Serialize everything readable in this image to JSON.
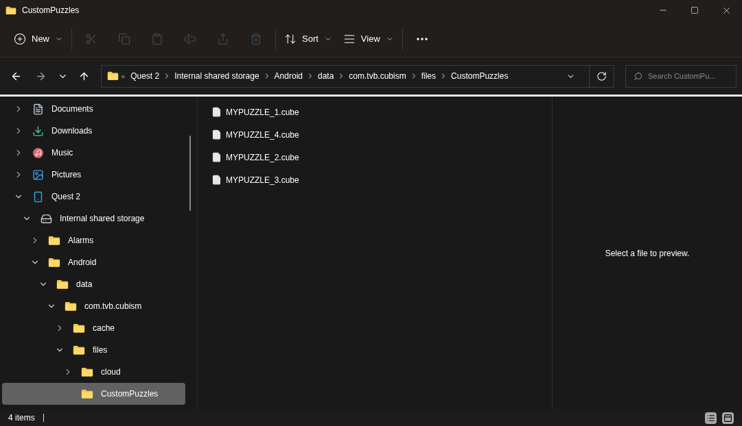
{
  "window": {
    "title": "CustomPuzzles"
  },
  "toolbar": {
    "items": [
      {
        "kind": "new",
        "label": "New",
        "disabled": false
      },
      {
        "kind": "cut",
        "disabled": true
      },
      {
        "kind": "copy",
        "disabled": true
      },
      {
        "kind": "paste",
        "disabled": true
      },
      {
        "kind": "rename",
        "disabled": true
      },
      {
        "kind": "share",
        "disabled": true
      },
      {
        "kind": "delete",
        "disabled": true
      },
      {
        "kind": "sort",
        "label": "Sort",
        "disabled": false
      },
      {
        "kind": "view",
        "label": "View",
        "disabled": false
      },
      {
        "kind": "more",
        "disabled": false
      }
    ]
  },
  "navigation": {
    "back_disabled": false,
    "forward_disabled": true
  },
  "address_bar": {
    "overflow": "«",
    "segments": [
      "Quest 2",
      "Internal shared storage",
      "Android",
      "data",
      "com.tvb.cubism",
      "files",
      "CustomPuzzles"
    ]
  },
  "search": {
    "placeholder": "Search CustomPu..."
  },
  "sidebar": {
    "items": [
      {
        "label": "Documents",
        "kind": "document",
        "expanded": false,
        "selected": false
      },
      {
        "label": "Downloads",
        "kind": "download",
        "expanded": false,
        "selected": false
      },
      {
        "label": "Music",
        "kind": "music",
        "expanded": false,
        "selected": false
      },
      {
        "label": "Pictures",
        "kind": "pictures",
        "expanded": false,
        "selected": false
      },
      {
        "label": "Quest 2",
        "kind": "device",
        "expanded": true,
        "selected": false,
        "children": [
          {
            "label": "Internal shared storage",
            "kind": "drive",
            "expanded": true,
            "selected": false,
            "children": [
              {
                "label": "Alarms",
                "kind": "folder",
                "expanded": false,
                "selected": false
              },
              {
                "label": "Android",
                "kind": "folder",
                "expanded": true,
                "selected": false,
                "children": [
                  {
                    "label": "data",
                    "kind": "folder",
                    "expanded": true,
                    "selected": false,
                    "children": [
                      {
                        "label": "com.tvb.cubism",
                        "kind": "folder",
                        "expanded": true,
                        "selected": false,
                        "children": [
                          {
                            "label": "cache",
                            "kind": "folder",
                            "expanded": false,
                            "selected": false
                          },
                          {
                            "label": "files",
                            "kind": "folder",
                            "expanded": true,
                            "selected": false,
                            "children": [
                              {
                                "label": "cloud",
                                "kind": "folder",
                                "expanded": false,
                                "selected": false
                              },
                              {
                                "label": "CustomPuzzles",
                                "kind": "folder",
                                "selected": true
                              }
                            ]
                          }
                        ]
                      }
                    ]
                  }
                ]
              }
            ]
          }
        ]
      }
    ]
  },
  "files": [
    {
      "name": "MYPUZZLE_1.cube",
      "selected": false
    },
    {
      "name": "MYPUZZLE_4.cube",
      "selected": false
    },
    {
      "name": "MYPUZZLE_2.cube",
      "selected": false
    },
    {
      "name": "MYPUZZLE_3.cube",
      "selected": false
    }
  ],
  "preview": {
    "message": "Select a file to preview."
  },
  "status_bar": {
    "item_count": "4 items"
  }
}
